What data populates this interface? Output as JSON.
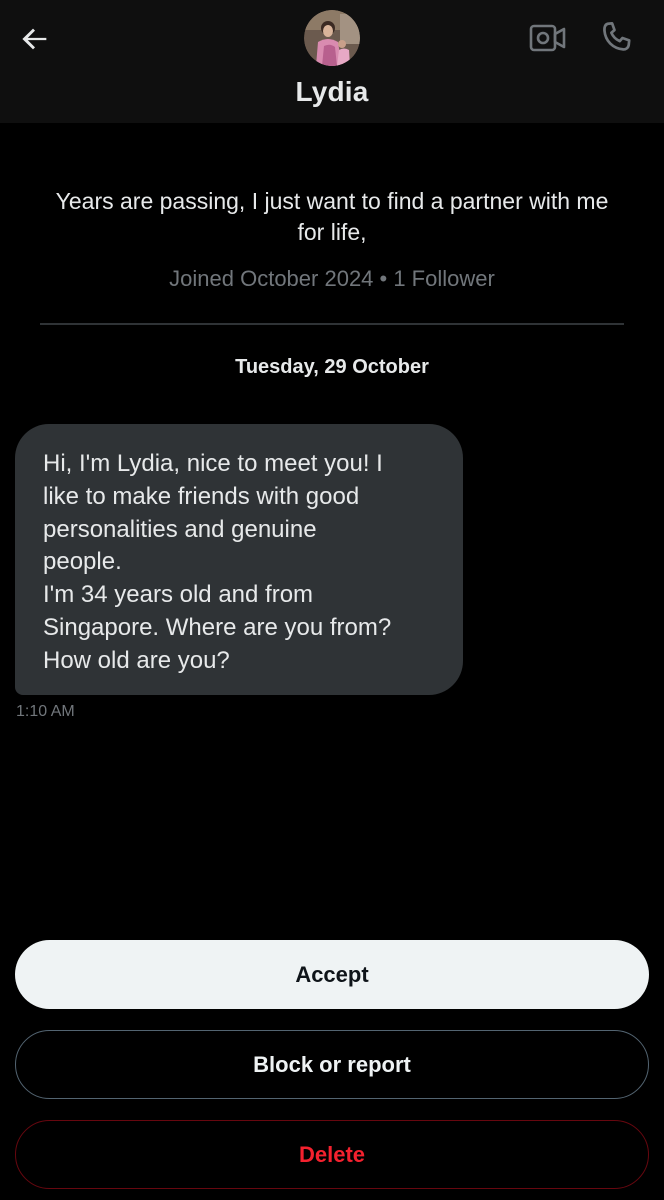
{
  "header": {
    "back_icon": "arrow-left-icon",
    "name": "Lydia",
    "video_icon": "video-camera-icon",
    "call_icon": "phone-icon"
  },
  "profile": {
    "bio": "Years are passing, I just want to find a partner with me for life,",
    "meta": "Joined October 2024 • 1 Follower"
  },
  "conversation": {
    "date_separator": "Tuesday, 29 October",
    "messages": [
      {
        "lines": [
          "Hi, I'm Lydia, nice to meet you! I",
          "like to make friends with good",
          "personalities and genuine",
          "people.",
          "I'm 34 years old and from",
          "Singapore. Where are you from?",
          "How old are you?"
        ],
        "time": "1:10 AM"
      }
    ]
  },
  "actions": {
    "accept": "Accept",
    "block_or_report": "Block or report",
    "delete": "Delete"
  },
  "colors": {
    "background": "#000000",
    "header_bg": "#0f0f0f",
    "bubble_bg": "#2f3336",
    "secondary_text": "#71767b",
    "accept_bg": "#eff3f4",
    "delete_red": "#f4212e"
  }
}
